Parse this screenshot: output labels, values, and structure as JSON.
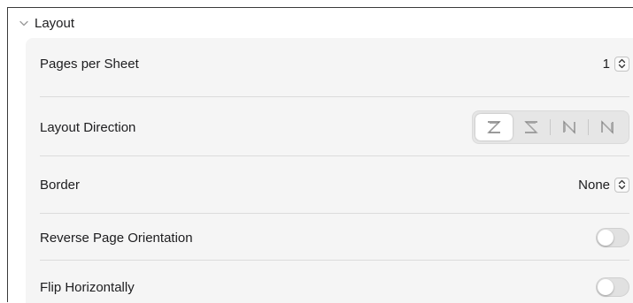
{
  "section": {
    "title": "Layout",
    "expanded": true,
    "chevron_icon": "chevron-down-icon"
  },
  "rows": [
    {
      "label": "Pages per Sheet",
      "control": "popup",
      "value": "1",
      "icon": "up-down-chevron-icon"
    },
    {
      "label": "Layout Direction",
      "control": "segmented",
      "selected_index": 0,
      "options": [
        "left-to-right-z-icon",
        "right-to-left-s-icon",
        "top-to-bottom-reverse-n-icon",
        "top-to-bottom-n-icon"
      ]
    },
    {
      "label": "Border",
      "control": "popup",
      "value": "None",
      "icon": "up-down-chevron-icon"
    },
    {
      "label": "Reverse Page Orientation",
      "control": "toggle",
      "on": false
    },
    {
      "label": "Flip Horizontally",
      "control": "toggle",
      "on": false
    }
  ],
  "colors": {
    "panel_background": "#f5f5f5",
    "toggle_off": "#e1e1e1",
    "segment_background": "#e6e6e6",
    "text": "#1d1d1f"
  }
}
